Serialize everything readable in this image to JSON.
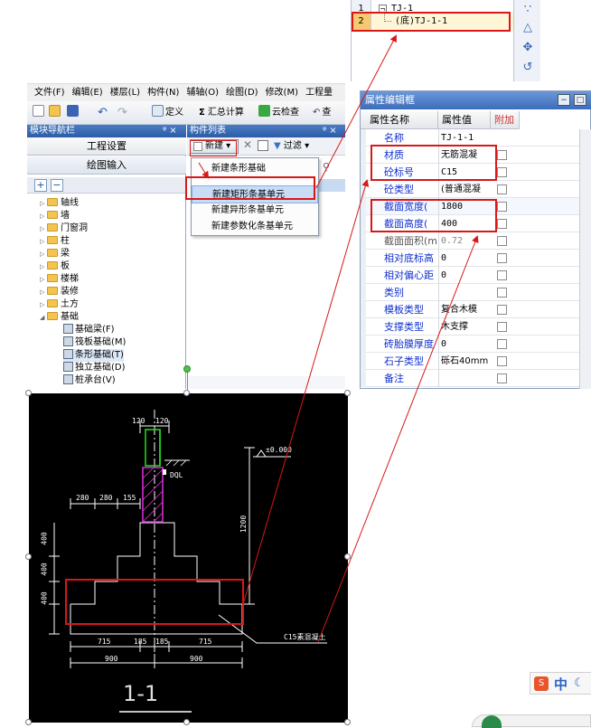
{
  "tree": {
    "rows": [
      {
        "num": "1",
        "toggle": "−",
        "text": "TJ-1"
      },
      {
        "num": "2",
        "text": "(底)TJ-1-1"
      }
    ]
  },
  "menubar": {
    "items": [
      "文件(F)",
      "编辑(E)",
      "楼层(L)",
      "构件(N)",
      "辅轴(O)",
      "绘图(D)",
      "修改(M)",
      "工程量"
    ]
  },
  "toolbar": {
    "define_label": "定义",
    "sum_label": "汇总计算",
    "check_label": "云检查",
    "more_label": "查"
  },
  "nav_panel": {
    "title": "模块导航栏",
    "pin": "ᵠ ×",
    "project_settings": "工程设置",
    "drawing_input": "绘图输入",
    "plus": "+",
    "minus": "−",
    "items": [
      "轴线",
      "墙",
      "门窗洞",
      "柱",
      "梁",
      "板",
      "楼梯",
      "装修",
      "土方",
      "基础"
    ],
    "sub_items": [
      "基础梁(F)",
      "筏板基础(M)",
      "条形基础(T)",
      "独立基础(D)",
      "桩承台(V)"
    ]
  },
  "comp_panel": {
    "title": "构件列表",
    "pin": "ᵠ ×",
    "new_label": "新建",
    "filter_label": "过滤"
  },
  "dropdown": {
    "items": [
      "新建条形基础",
      "新建矩形条基单元",
      "新建异形条基单元",
      "新建参数化条基单元"
    ]
  },
  "prop_editor": {
    "title": "属性编辑框",
    "headers": {
      "name": "属性名称",
      "value": "属性值",
      "extra": "附加"
    },
    "rows": [
      {
        "name": "名称",
        "value": "TJ-1-1"
      },
      {
        "name": "材质",
        "value": "无筋混凝"
      },
      {
        "name": "砼标号",
        "value": "C15"
      },
      {
        "name": "砼类型",
        "value": "(普通混凝"
      },
      {
        "name": "截面宽度(",
        "value": "1800"
      },
      {
        "name": "截面高度(",
        "value": "400"
      },
      {
        "name": "截面面积(m",
        "value": "0.72"
      },
      {
        "name": "相对底标高",
        "value": "0"
      },
      {
        "name": "相对偏心距",
        "value": "0"
      },
      {
        "name": "类别",
        "value": ""
      },
      {
        "name": "模板类型",
        "value": "复合木模"
      },
      {
        "name": "支撑类型",
        "value": "木支撑"
      },
      {
        "name": "砖胎膜厚度",
        "value": "0"
      },
      {
        "name": "石子类型",
        "value": "砾石40mm"
      },
      {
        "name": "备注",
        "value": ""
      }
    ]
  },
  "cad": {
    "dim_top": [
      "120",
      "120"
    ],
    "elev": "±0.000",
    "dql": "DQL",
    "dims_left": [
      "280",
      "280",
      "155"
    ],
    "dims_vertical": [
      "400",
      "400",
      "400"
    ],
    "dim_1200": "1200",
    "dims_bottom": [
      "715",
      "185",
      "185",
      "715"
    ],
    "dims_total": [
      "900",
      "900"
    ],
    "concrete_note": "C15素混凝土",
    "section_label": "1-1"
  },
  "ime": {
    "label": "中",
    "icon_label": "S"
  }
}
